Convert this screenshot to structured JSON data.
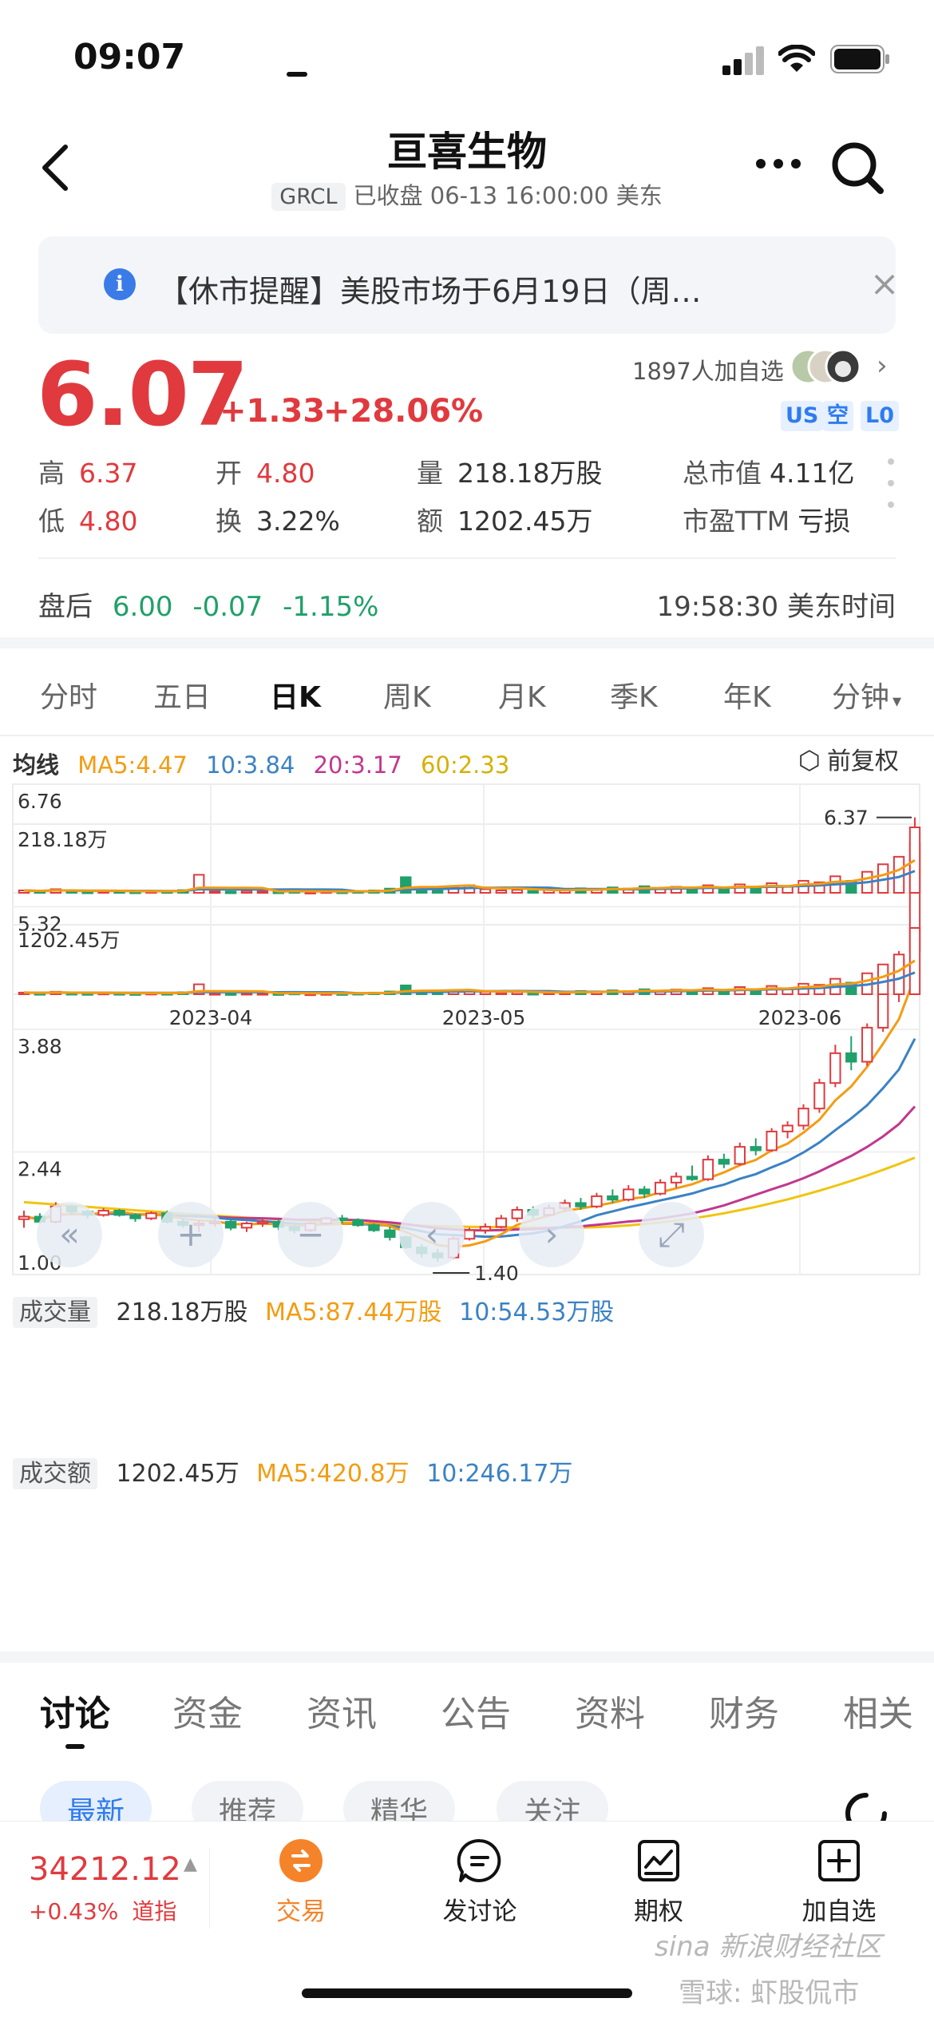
{
  "status_bar": {
    "time": "09:07"
  },
  "header": {
    "title": "亘喜生物",
    "ticker": "GRCL",
    "market_status": "已收盘 06-13 16:00:00 美东"
  },
  "notice": {
    "text": "【休市提醒】美股市场于6月19日（周…"
  },
  "quote": {
    "price": "6.07",
    "change": "+1.33",
    "change_pct": "+28.06%",
    "watchlist_count": "1897人加自选",
    "tags": [
      "US",
      "空",
      "L0"
    ],
    "stats": {
      "high_label": "高",
      "high": "6.37",
      "open_label": "开",
      "open": "4.80",
      "volume_label": "量",
      "volume": "218.18万股",
      "mktcap_label": "总市值",
      "mktcap": "4.11亿",
      "low_label": "低",
      "low": "4.80",
      "turnover_label": "换",
      "turnover": "3.22%",
      "amount_label": "额",
      "amount": "1202.45万",
      "pe_label": "市盈TTM",
      "pe": "亏损"
    },
    "after_hours": {
      "label": "盘后",
      "price": "6.00",
      "change": "-0.07",
      "change_pct": "-1.15%",
      "time": "19:58:30 美东时间"
    }
  },
  "period_tabs": [
    "分时",
    "五日",
    "日K",
    "周K",
    "月K",
    "季K",
    "年K",
    "分钟"
  ],
  "active_period": "日K",
  "ma_legend": {
    "label": "均线",
    "ma5": "MA5:4.47",
    "ma10": "10:3.84",
    "ma20": "20:3.17",
    "ma60": "60:2.33",
    "adjust": "前复权"
  },
  "colors": {
    "up": "#e03a3e",
    "down": "#20a06a",
    "ma5": "#f39c12",
    "ma10": "#3b82c4",
    "ma20": "#c2378f",
    "ma60": "#f1c40f"
  },
  "chart_data": {
    "type": "candlestick",
    "y_ticks": [
      "6.76",
      "5.32",
      "3.88",
      "2.44",
      "1.00"
    ],
    "ylim": [
      1.0,
      6.76
    ],
    "x_labels": [
      "2023-04",
      "2023-05",
      "2023-06"
    ],
    "high_marker": "6.37",
    "low_marker": "1.40",
    "volume": {
      "label": "成交量",
      "value": "218.18万股",
      "ma5": "MA5:87.44万股",
      "ma10": "10:54.53万股",
      "max_label": "218.18万"
    },
    "amount": {
      "label": "成交额",
      "value": "1202.45万",
      "ma5": "MA5:420.8万",
      "ma10": "10:246.17万",
      "max_label": "1202.45万"
    },
    "candles": [
      [
        1.65,
        1.75,
        1.55,
        1.68
      ],
      [
        1.68,
        1.72,
        1.6,
        1.62
      ],
      [
        1.62,
        1.85,
        1.6,
        1.8
      ],
      [
        1.8,
        1.82,
        1.7,
        1.74
      ],
      [
        1.74,
        1.76,
        1.66,
        1.7
      ],
      [
        1.7,
        1.78,
        1.68,
        1.75
      ],
      [
        1.75,
        1.77,
        1.68,
        1.7
      ],
      [
        1.7,
        1.72,
        1.62,
        1.66
      ],
      [
        1.66,
        1.74,
        1.64,
        1.72
      ],
      [
        1.72,
        1.75,
        1.6,
        1.62
      ],
      [
        1.62,
        1.66,
        1.55,
        1.58
      ],
      [
        1.58,
        1.64,
        1.5,
        1.6
      ],
      [
        1.6,
        1.66,
        1.56,
        1.62
      ],
      [
        1.62,
        1.64,
        1.52,
        1.55
      ],
      [
        1.55,
        1.62,
        1.5,
        1.6
      ],
      [
        1.6,
        1.66,
        1.56,
        1.62
      ],
      [
        1.62,
        1.64,
        1.52,
        1.56
      ],
      [
        1.56,
        1.58,
        1.48,
        1.52
      ],
      [
        1.52,
        1.62,
        1.5,
        1.6
      ],
      [
        1.6,
        1.68,
        1.58,
        1.66
      ],
      [
        1.66,
        1.7,
        1.6,
        1.64
      ],
      [
        1.64,
        1.66,
        1.56,
        1.58
      ],
      [
        1.58,
        1.6,
        1.5,
        1.52
      ],
      [
        1.52,
        1.56,
        1.4,
        1.44
      ],
      [
        1.44,
        1.46,
        1.3,
        1.32
      ],
      [
        1.32,
        1.36,
        1.2,
        1.25
      ],
      [
        1.25,
        1.3,
        1.15,
        1.2
      ],
      [
        1.2,
        1.45,
        1.18,
        1.42
      ],
      [
        1.42,
        1.55,
        1.4,
        1.52
      ],
      [
        1.52,
        1.6,
        1.48,
        1.56
      ],
      [
        1.56,
        1.7,
        1.54,
        1.66
      ],
      [
        1.66,
        1.8,
        1.62,
        1.76
      ],
      [
        1.76,
        1.8,
        1.66,
        1.7
      ],
      [
        1.7,
        1.82,
        1.68,
        1.78
      ],
      [
        1.78,
        1.88,
        1.74,
        1.84
      ],
      [
        1.84,
        1.9,
        1.76,
        1.8
      ],
      [
        1.8,
        1.96,
        1.78,
        1.92
      ],
      [
        1.92,
        2.0,
        1.84,
        1.88
      ],
      [
        1.88,
        2.05,
        1.86,
        2.0
      ],
      [
        2.0,
        2.04,
        1.9,
        1.95
      ],
      [
        1.95,
        2.12,
        1.93,
        2.08
      ],
      [
        2.08,
        2.2,
        2.02,
        2.15
      ],
      [
        2.15,
        2.28,
        2.1,
        2.12
      ],
      [
        2.12,
        2.4,
        2.1,
        2.35
      ],
      [
        2.35,
        2.42,
        2.25,
        2.3
      ],
      [
        2.3,
        2.55,
        2.28,
        2.5
      ],
      [
        2.5,
        2.6,
        2.4,
        2.46
      ],
      [
        2.46,
        2.72,
        2.44,
        2.68
      ],
      [
        2.68,
        2.8,
        2.6,
        2.75
      ],
      [
        2.75,
        3.0,
        2.7,
        2.95
      ],
      [
        2.95,
        3.3,
        2.9,
        3.25
      ],
      [
        3.25,
        3.7,
        3.2,
        3.6
      ],
      [
        3.6,
        3.8,
        3.4,
        3.5
      ],
      [
        3.5,
        3.95,
        3.45,
        3.9
      ],
      [
        3.9,
        4.4,
        3.85,
        4.3
      ],
      [
        4.3,
        4.8,
        4.2,
        4.7
      ],
      [
        4.8,
        6.37,
        4.8,
        6.07
      ]
    ],
    "volumes": [
      8,
      5,
      12,
      6,
      4,
      7,
      5,
      4,
      6,
      5,
      9,
      60,
      5,
      4,
      6,
      5,
      4,
      7,
      3,
      5,
      4,
      6,
      8,
      14,
      52,
      16,
      9,
      20,
      25,
      12,
      8,
      10,
      6,
      12,
      8,
      15,
      10,
      18,
      14,
      22,
      16,
      20,
      15,
      25,
      12,
      28,
      18,
      32,
      22,
      40,
      35,
      55,
      40,
      70,
      95,
      120,
      218
    ],
    "amounts": [
      30,
      20,
      45,
      22,
      18,
      26,
      20,
      16,
      24,
      20,
      35,
      180,
      20,
      16,
      22,
      20,
      16,
      26,
      12,
      18,
      16,
      22,
      30,
      50,
      160,
      55,
      32,
      65,
      80,
      40,
      30,
      36,
      22,
      44,
      30,
      58,
      38,
      70,
      55,
      90,
      65,
      85,
      62,
      110,
      55,
      130,
      80,
      150,
      100,
      190,
      170,
      280,
      210,
      380,
      540,
      720,
      1202
    ]
  },
  "chart_controls": [
    "«",
    "+",
    "−",
    "‹",
    "›",
    "⤢"
  ],
  "section_tabs": [
    "讨论",
    "资金",
    "资讯",
    "公告",
    "资料",
    "财务",
    "相关"
  ],
  "filter_pills": [
    "最新",
    "推荐",
    "精华",
    "关注"
  ],
  "bottom_bar": {
    "index_value": "34212.12",
    "index_change": "+0.43%",
    "index_name": "道指",
    "items": [
      "交易",
      "发讨论",
      "期权",
      "加自选"
    ]
  },
  "watermark": {
    "line1": "sina 新浪财经社区",
    "line2": "雪球: 虾股侃市"
  }
}
